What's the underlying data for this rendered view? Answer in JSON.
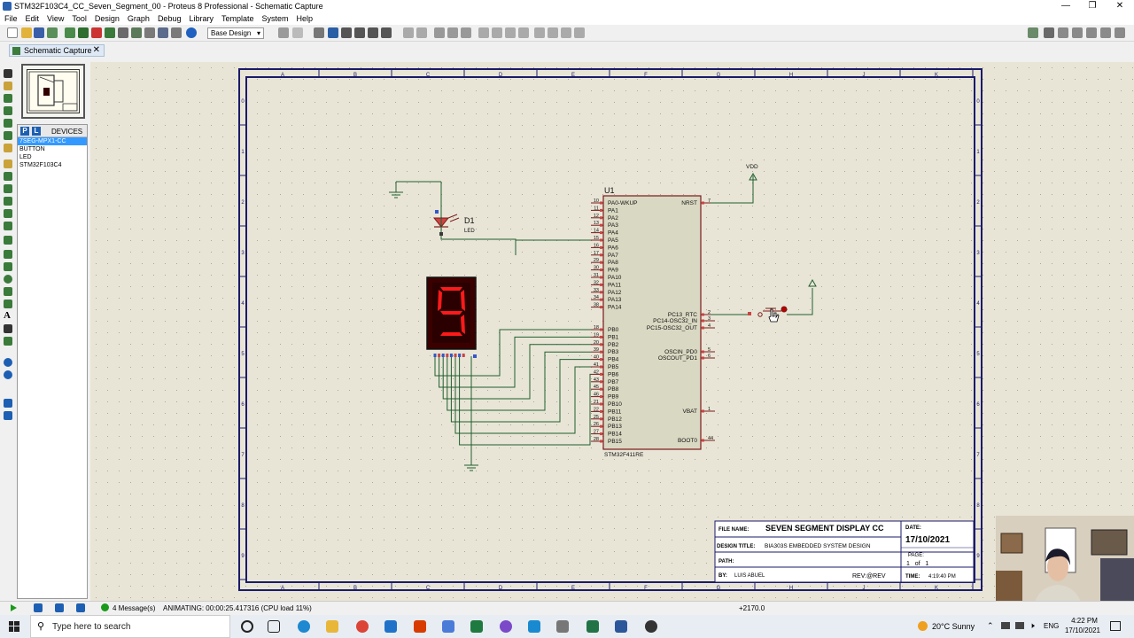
{
  "window": {
    "title": "STM32F103C4_CC_Seven_Segment_00 - Proteus 8 Professional - Schematic Capture"
  },
  "menu": [
    "File",
    "Edit",
    "View",
    "Tool",
    "Design",
    "Graph",
    "Debug",
    "Library",
    "Template",
    "System",
    "Help"
  ],
  "toolbar": {
    "layer_select": "Base Design"
  },
  "tab": {
    "label": "Schematic Capture"
  },
  "devices": {
    "header": "DEVICES",
    "p": "P",
    "l": "L",
    "items": [
      "7SEG-MPX1-CC",
      "BUTTON",
      "LED",
      "STM32F103C4"
    ],
    "selected": 0
  },
  "schematic": {
    "cols": [
      "A",
      "B",
      "C",
      "D",
      "E",
      "F",
      "G",
      "H",
      "J",
      "K"
    ],
    "rows": [
      "0",
      "1",
      "2",
      "3",
      "4",
      "5",
      "6",
      "7",
      "8",
      "9"
    ],
    "vdd": "VDD",
    "led": {
      "ref": "D1",
      "value": "LED"
    },
    "display_digit": "9",
    "mcu": {
      "ref": "U1",
      "part": "STM32F411RE",
      "left_pins": [
        {
          "num": "10",
          "name": "PA0-WKUP"
        },
        {
          "num": "11",
          "name": "PA1"
        },
        {
          "num": "12",
          "name": "PA2"
        },
        {
          "num": "13",
          "name": "PA3"
        },
        {
          "num": "14",
          "name": "PA4"
        },
        {
          "num": "15",
          "name": "PA5"
        },
        {
          "num": "16",
          "name": "PA6"
        },
        {
          "num": "17",
          "name": "PA7"
        },
        {
          "num": "29",
          "name": "PA8"
        },
        {
          "num": "30",
          "name": "PA9"
        },
        {
          "num": "31",
          "name": "PA10"
        },
        {
          "num": "32",
          "name": "PA11"
        },
        {
          "num": "33",
          "name": "PA12"
        },
        {
          "num": "34",
          "name": "PA13"
        },
        {
          "num": "38",
          "name": "PA14"
        },
        {
          "num": "18",
          "name": "PB0"
        },
        {
          "num": "19",
          "name": "PB1"
        },
        {
          "num": "20",
          "name": "PB2"
        },
        {
          "num": "39",
          "name": "PB3"
        },
        {
          "num": "40",
          "name": "PB4"
        },
        {
          "num": "41",
          "name": "PB5"
        },
        {
          "num": "42",
          "name": "PB6"
        },
        {
          "num": "43",
          "name": "PB7"
        },
        {
          "num": "45",
          "name": "PB8"
        },
        {
          "num": "46",
          "name": "PB9"
        },
        {
          "num": "21",
          "name": "PB10"
        },
        {
          "num": "22",
          "name": "PB11"
        },
        {
          "num": "25",
          "name": "PB12"
        },
        {
          "num": "26",
          "name": "PB13"
        },
        {
          "num": "27",
          "name": "PB14"
        },
        {
          "num": "28",
          "name": "PB15"
        }
      ],
      "right_pins": [
        {
          "num": "7",
          "name": "NRST"
        },
        {
          "num": "2",
          "name": "PC13_RTC"
        },
        {
          "num": "3",
          "name": "PC14-OSC32_IN"
        },
        {
          "num": "4",
          "name": "PC15-OSC32_OUT"
        },
        {
          "num": "5",
          "name": "OSCIN_PD0"
        },
        {
          "num": "6",
          "name": "OSCOUT_PD1"
        },
        {
          "num": "1",
          "name": "VBAT"
        },
        {
          "num": "44",
          "name": "BOOT0"
        }
      ]
    },
    "titleblock": {
      "file_name_label": "FILE NAME:",
      "file_name": "SEVEN SEGMENT DISPLAY CC",
      "date_label": "DATE:",
      "date": "17/10/2021",
      "design_title_label": "DESIGN TITLE:",
      "design_title": "BIA303S EMBEDDED SYSTEM DESIGN",
      "path_label": "PATH:",
      "page_label": "PAGE:",
      "page_of": "1   of   1",
      "by_label": "BY:",
      "by": "LUIS ABUEL",
      "rev": "REV:@REV",
      "time_label": "TIME:",
      "time": "4:19:40 PM"
    }
  },
  "status": {
    "messages": "4 Message(s)",
    "animating": "ANIMATING: 00:00:25.417316 (CPU load 11%)",
    "coords": "+2170.0"
  },
  "taskbar": {
    "search_placeholder": "Type here to search",
    "weather": "20°C  Sunny",
    "lang": "ENG",
    "time": "4:22 PM",
    "date": "17/10/2021"
  }
}
